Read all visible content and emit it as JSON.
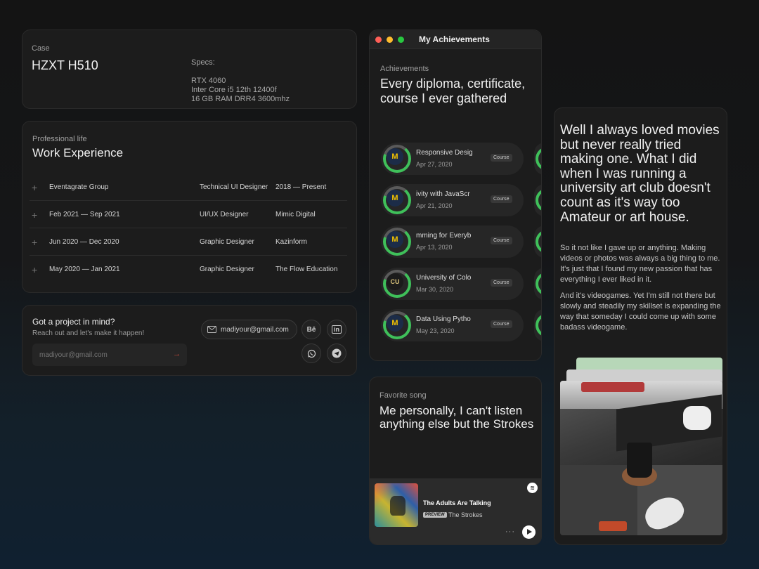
{
  "case": {
    "label": "Case",
    "name": "HZXT H510",
    "specs_label": "Specs:",
    "specs": [
      "RTX 4060",
      "Inter Core i5 12th 12400f",
      "16 GB RAM DRR4 3600mhz"
    ]
  },
  "work": {
    "label": "Professional life",
    "title": "Work Experience",
    "rows": [
      {
        "period": "Eventagrate Group",
        "role": "Technical UI Designer",
        "company": "2018 — Present"
      },
      {
        "period": "Feb  2021 — Sep 2021",
        "role": "UI/UX Designer",
        "company": "Mimic Digital"
      },
      {
        "period": "Jun 2020 — Dec 2020",
        "role": "Graphic Designer",
        "company": "Kazinform"
      },
      {
        "period": "May 2020 — Jan 2021",
        "role": "Graphic Designer",
        "company": "The Flow Education"
      }
    ]
  },
  "contact": {
    "heading": "Got a project in mind?",
    "sub": "Reach out and let's make it happen!",
    "input_placeholder": "madiyour@gmail.com",
    "send_glyph": "→",
    "email": "madiyour@gmail.com",
    "behance_label": "Bē",
    "linkedin_label": "in"
  },
  "achievements": {
    "window_title": "My Achievements",
    "label": "Achievements",
    "title": "Every diploma, certificate, course I ever gathered",
    "items": [
      {
        "name": "Responsive Desig",
        "date": "Apr 27, 2020",
        "badge": "Course",
        "logo": "M"
      },
      {
        "name": "ivity with JavaScr",
        "date": "Apr 21, 2020",
        "badge": "Course",
        "logo": "M"
      },
      {
        "name": "mming for Everyb",
        "date": "Apr 13, 2020",
        "badge": "Course",
        "logo": "M"
      },
      {
        "name": "University of Colo",
        "date": "Mar 30, 2020",
        "badge": "Course",
        "logo": "CU"
      },
      {
        "name": "Data  Using Pytho",
        "date": "May 23, 2020",
        "badge": "Course",
        "logo": "M"
      }
    ]
  },
  "song": {
    "label": "Favorite song",
    "title": "Me personally, I can't listen anything else but the Strokes",
    "track": "The Adults Are Talking",
    "preview_badge": "PREVIEW",
    "artist": "The Strokes",
    "more": "···"
  },
  "story": {
    "headline": "Well I always loved movies but never really tried making one. What I did when I was running a university art club doesn't count as it's way too Amateur or art house.",
    "p1": "So it not like I gave up or anything. Making videos or photos was always a big thing to me. It's just that I found my new passion that has everything I ever liked in it.",
    "p2": "And it's videogames. Yet I'm still not there but slowly and steadily my skillset is expanding the way that someday I could come up with some badass videogame."
  },
  "colors": {
    "accent_green": "#3fc05a",
    "send_red": "#d14b3b",
    "close_dot": "#ff5f57",
    "minimize_dot": "#febc2e",
    "zoom_dot": "#28c840"
  }
}
